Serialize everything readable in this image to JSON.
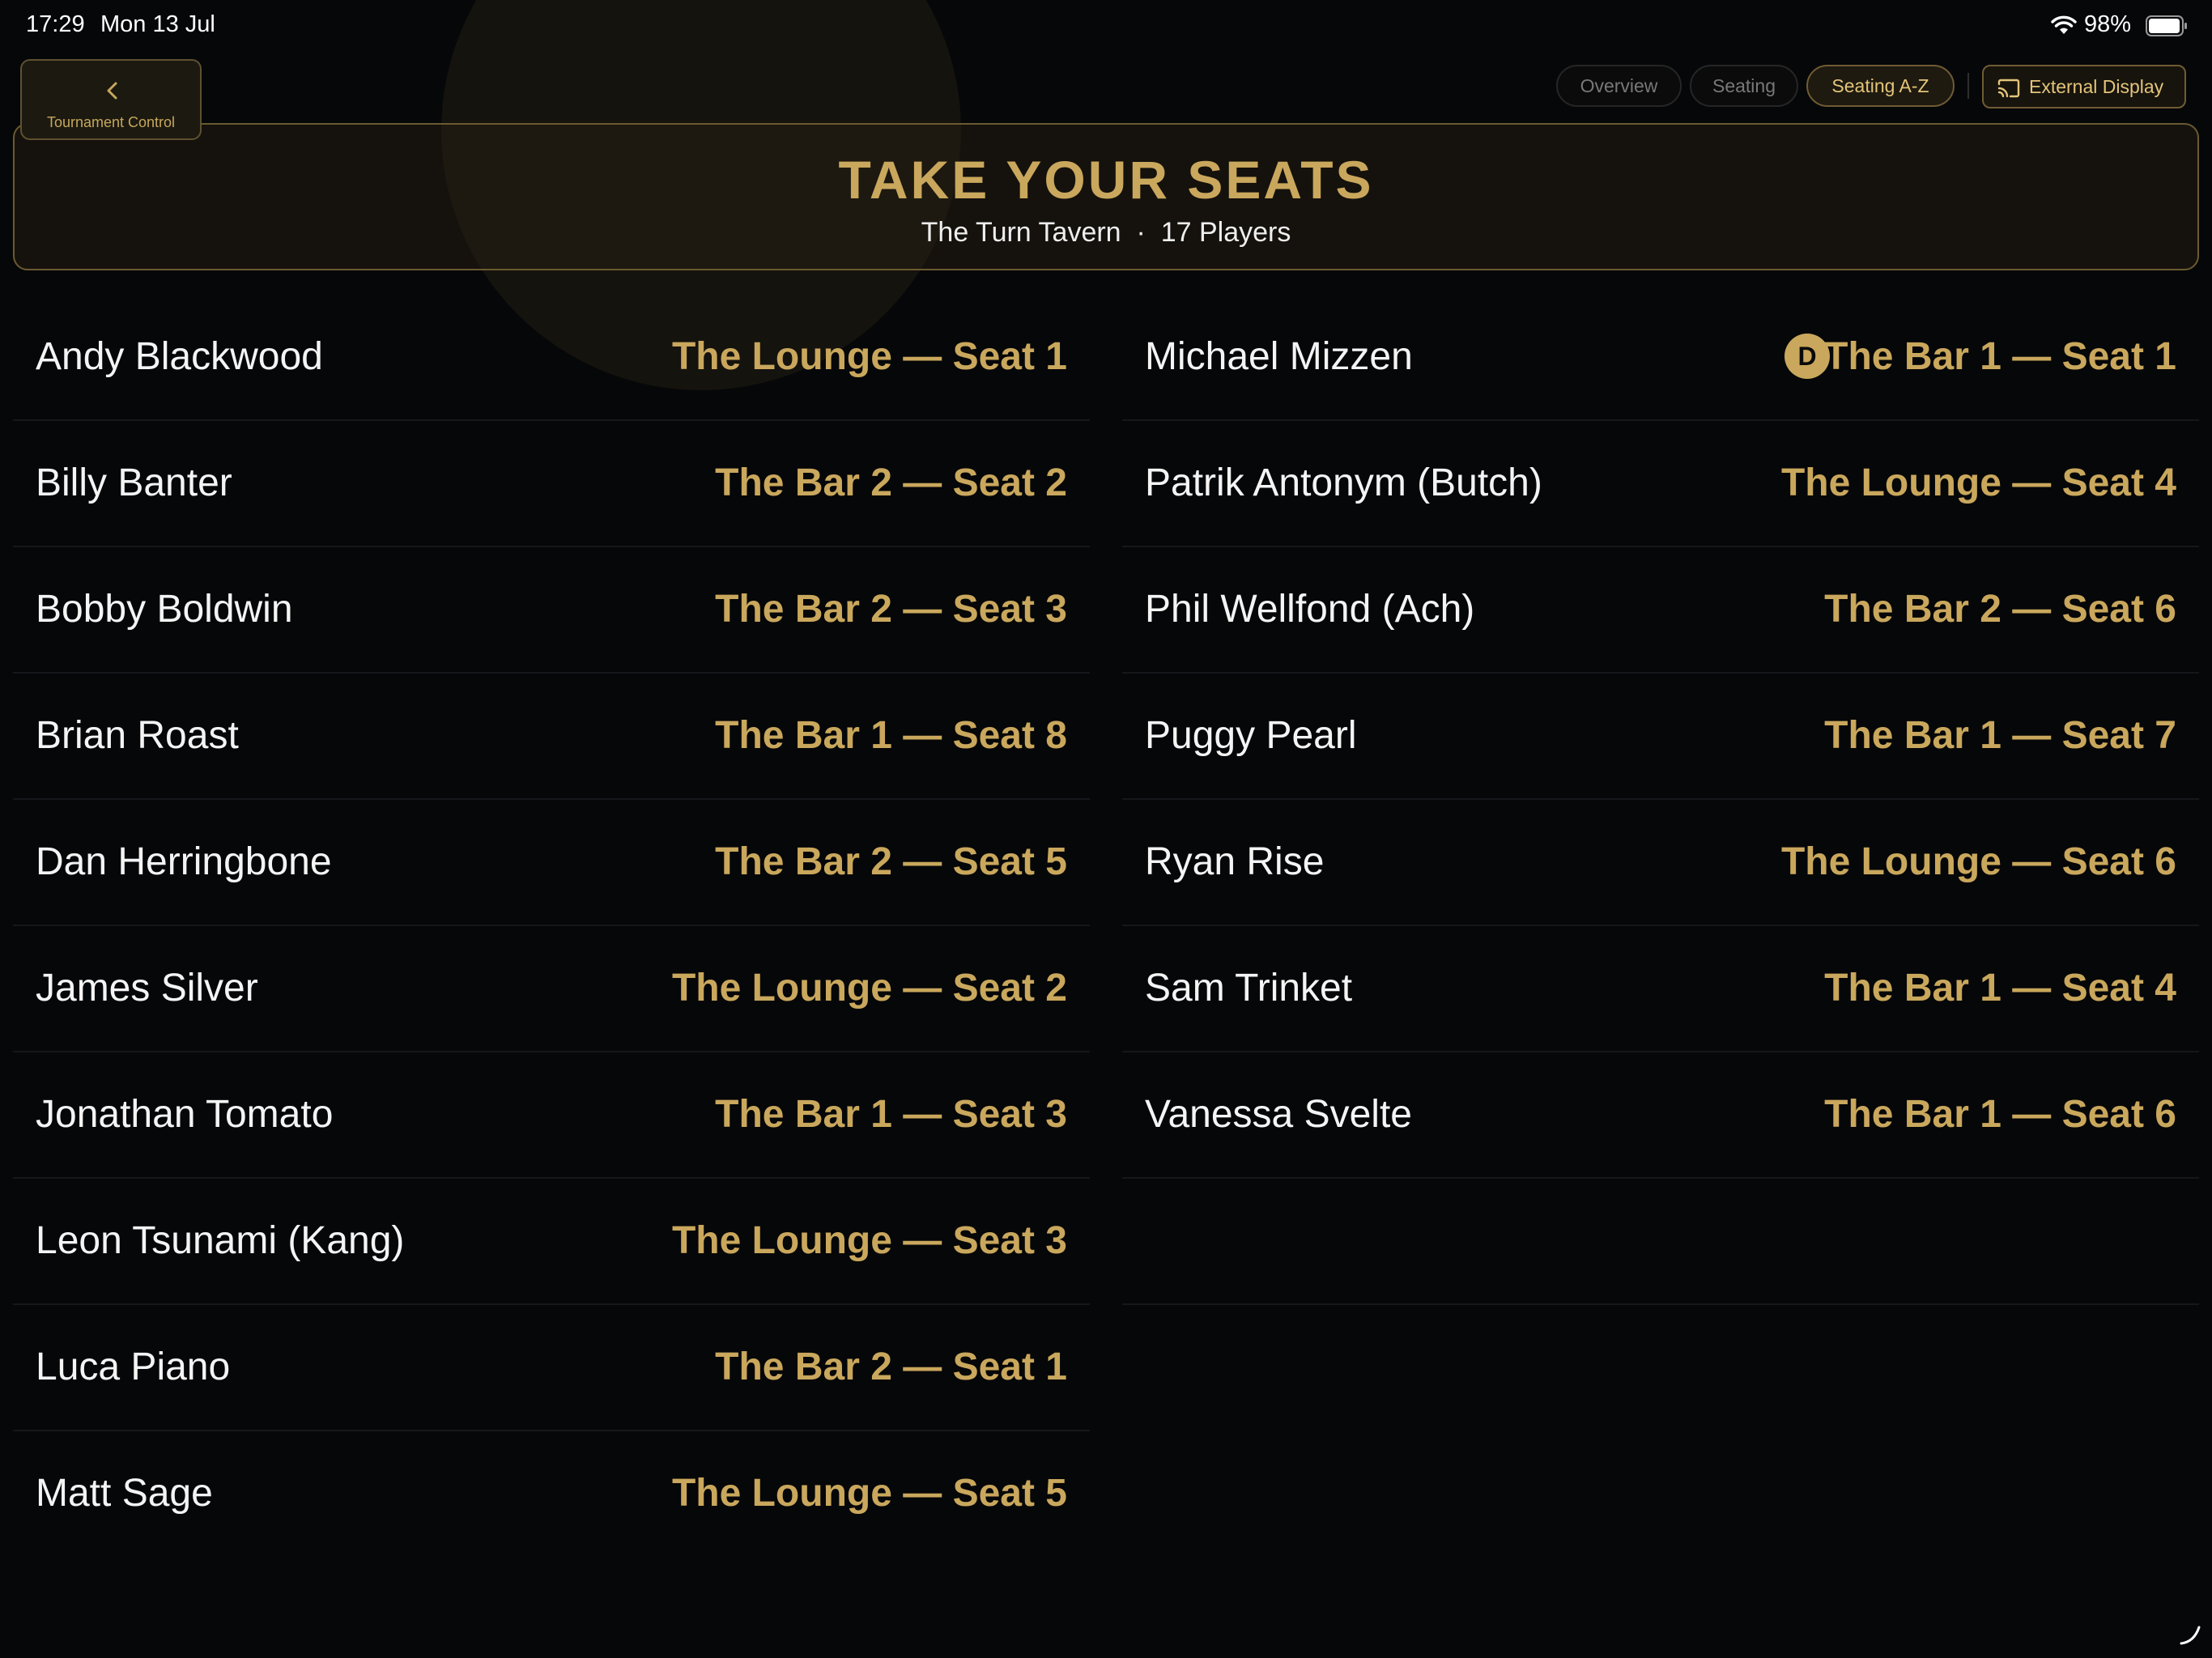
{
  "status_bar": {
    "time": "17:29",
    "date": "Mon 13 Jul",
    "battery": "98%"
  },
  "back_button": {
    "label": "Tournament Control",
    "icon": "chevron-left-icon"
  },
  "tabs": [
    {
      "label": "Overview",
      "active": false
    },
    {
      "label": "Seating",
      "active": false
    },
    {
      "label": "Seating A-Z",
      "active": true
    }
  ],
  "external_display": {
    "label": "External Display",
    "icon": "cast-icon"
  },
  "banner": {
    "title": "TAKE YOUR SEATS",
    "subtitle": "The Turn Tavern  ·  17 Players"
  },
  "colors": {
    "accent_gold": "#c9a75c",
    "background": "#060709"
  },
  "players_left": [
    {
      "name": "Andy Blackwood",
      "seat": "The Lounge — Seat 1"
    },
    {
      "name": "Billy Banter",
      "seat": "The Bar 2 — Seat 2"
    },
    {
      "name": "Bobby Boldwin",
      "seat": "The Bar 2 — Seat 3"
    },
    {
      "name": "Brian Roast",
      "seat": "The Bar 1 — Seat 8"
    },
    {
      "name": "Dan Herringbone",
      "seat": "The Bar 2 — Seat 5"
    },
    {
      "name": "James Silver",
      "seat": "The Lounge — Seat 2"
    },
    {
      "name": "Jonathan Tomato",
      "seat": "The Bar 1 — Seat 3"
    },
    {
      "name": "Leon Tsunami (Kang)",
      "seat": "The Lounge — Seat 3"
    },
    {
      "name": "Luca Piano",
      "seat": "The Bar 2 — Seat 1"
    },
    {
      "name": "Matt Sage",
      "seat": "The Lounge — Seat 5"
    }
  ],
  "players_right": [
    {
      "name": "Michael Mizzen",
      "seat": "The Bar 1 — Seat 1",
      "dealer_badge": "D"
    },
    {
      "name": "Patrik Antonym (Butch)",
      "seat": "The Lounge — Seat 4"
    },
    {
      "name": "Phil Wellfond (Ach)",
      "seat": "The Bar 2 — Seat 6"
    },
    {
      "name": "Puggy Pearl",
      "seat": "The Bar 1 — Seat 7"
    },
    {
      "name": "Ryan Rise",
      "seat": "The Lounge — Seat 6"
    },
    {
      "name": "Sam Trinket",
      "seat": "The Bar 1 — Seat 4"
    },
    {
      "name": "Vanessa Svelte",
      "seat": "The Bar 1 — Seat 6"
    }
  ]
}
